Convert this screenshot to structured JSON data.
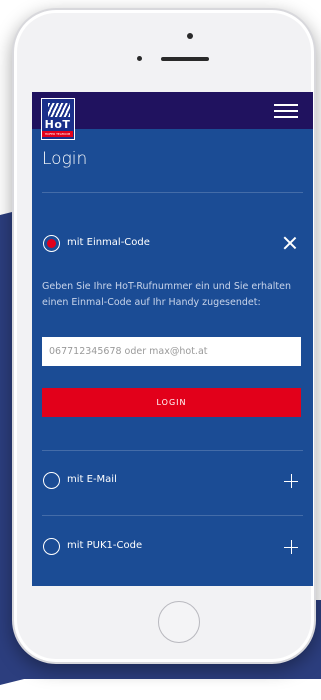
{
  "brand": {
    "logo_text": "HoT",
    "logo_sub": "HOFER TELEKOM"
  },
  "header": {
    "page_title": "Login"
  },
  "options": [
    {
      "label": "mit Einmal-Code",
      "selected": true
    },
    {
      "label": "mit E-Mail",
      "selected": false
    },
    {
      "label": "mit PUK1-Code",
      "selected": false
    }
  ],
  "einmal": {
    "description": "Geben Sie Ihre HoT-Rufnummer ein und Sie erhalten einen Einmal-Code auf Ihr Handy zugesendet:",
    "input_placeholder": "067712345678 oder max@hot.at",
    "input_value": "",
    "login_label": "LOGIN"
  },
  "colors": {
    "screen_bg": "#1b4c95",
    "topbar_bg": "#20125f",
    "accent_red": "#e2001a"
  }
}
